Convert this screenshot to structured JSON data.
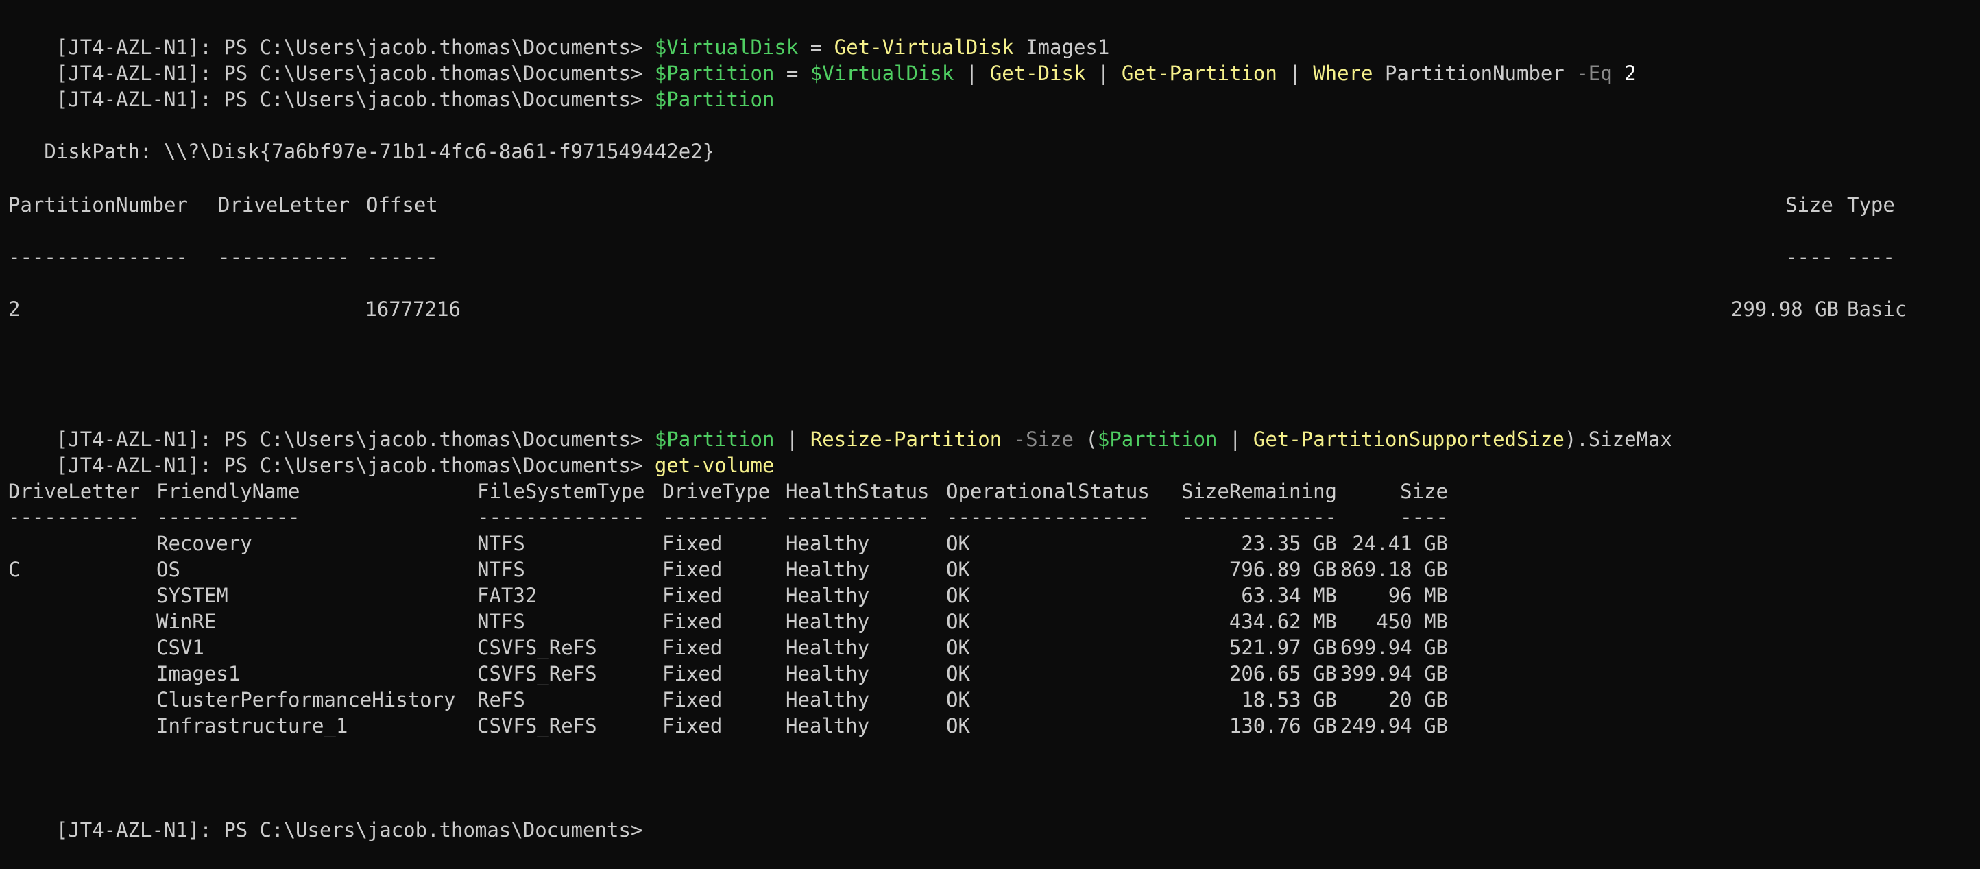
{
  "terminal": {
    "prompt": "[JT4-AZL-N1]: PS C:\\Users\\jacob.thomas\\Documents> ",
    "colors": {
      "background": "#0c0c0c",
      "foreground": "#cccccc",
      "variable": "#4fce62",
      "command": "#f5f08b",
      "parameter": "#8a8a8a"
    },
    "cmd1": {
      "var": "$VirtualDisk",
      "op": " = ",
      "cmd": "Get-VirtualDisk",
      "arg": " Images1"
    },
    "cmd2": {
      "var": "$Partition",
      "op": " = ",
      "var2": "$VirtualDisk",
      "pipe1": " | ",
      "cmd1": "Get-Disk",
      "pipe2": " | ",
      "cmd2": "Get-Partition",
      "pipe3": " | ",
      "where": "Where",
      "arg": " PartitionNumber ",
      "param": "-Eq",
      "num": " 2"
    },
    "cmd3": {
      "var": "$Partition"
    },
    "partition_output": {
      "disk_path": "   DiskPath: \\\\?\\Disk{7a6bf97e-71b1-4fc6-8a61-f971549442e2}",
      "headers": {
        "number": "PartitionNumber",
        "letter": "DriveLetter",
        "offset": "Offset",
        "size": "Size",
        "type": "Type"
      },
      "dashes": {
        "number": "---------------",
        "letter": "-----------",
        "offset": "------",
        "size": "----",
        "type": "----"
      },
      "row": {
        "number": "2",
        "letter": "",
        "offset": "16777216",
        "size": "299.98 GB",
        "type": "Basic"
      }
    },
    "cmd4": {
      "var": "$Partition",
      "pipe1": " | ",
      "cmd1": "Resize-Partition",
      "sp": " ",
      "param": "-Size",
      "open": " (",
      "var2": "$Partition",
      "pipe2": " | ",
      "cmd2": "Get-PartitionSupportedSize",
      "close": ").SizeMax"
    },
    "cmd5": {
      "cmd": "get-volume"
    },
    "volume_table": {
      "headers": {
        "letter": "DriveLetter",
        "name": "FriendlyName",
        "fs": "FileSystemType",
        "dtype": "DriveType",
        "health": "HealthStatus",
        "op": "OperationalStatus",
        "remaining": "SizeRemaining",
        "size": "Size"
      },
      "dashes": {
        "letter": "-----------",
        "name": "------------",
        "fs": "--------------",
        "dtype": "---------",
        "health": "------------",
        "op": "-----------------",
        "remaining": "-------------",
        "size": "----"
      },
      "rows": [
        {
          "letter": "",
          "name": "Recovery",
          "fs": "NTFS",
          "dtype": "Fixed",
          "health": "Healthy",
          "op": "OK",
          "remaining": "23.35 GB",
          "size": "24.41 GB"
        },
        {
          "letter": "C",
          "name": "OS",
          "fs": "NTFS",
          "dtype": "Fixed",
          "health": "Healthy",
          "op": "OK",
          "remaining": "796.89 GB",
          "size": "869.18 GB"
        },
        {
          "letter": "",
          "name": "SYSTEM",
          "fs": "FAT32",
          "dtype": "Fixed",
          "health": "Healthy",
          "op": "OK",
          "remaining": "63.34 MB",
          "size": "96 MB"
        },
        {
          "letter": "",
          "name": "WinRE",
          "fs": "NTFS",
          "dtype": "Fixed",
          "health": "Healthy",
          "op": "OK",
          "remaining": "434.62 MB",
          "size": "450 MB"
        },
        {
          "letter": "",
          "name": "CSV1",
          "fs": "CSVFS_ReFS",
          "dtype": "Fixed",
          "health": "Healthy",
          "op": "OK",
          "remaining": "521.97 GB",
          "size": "699.94 GB"
        },
        {
          "letter": "",
          "name": "Images1",
          "fs": "CSVFS_ReFS",
          "dtype": "Fixed",
          "health": "Healthy",
          "op": "OK",
          "remaining": "206.65 GB",
          "size": "399.94 GB"
        },
        {
          "letter": "",
          "name": "ClusterPerformanceHistory",
          "fs": "ReFS",
          "dtype": "Fixed",
          "health": "Healthy",
          "op": "OK",
          "remaining": "18.53 GB",
          "size": "20 GB"
        },
        {
          "letter": "",
          "name": "Infrastructure_1",
          "fs": "CSVFS_ReFS",
          "dtype": "Fixed",
          "health": "Healthy",
          "op": "OK",
          "remaining": "130.76 GB",
          "size": "249.94 GB"
        }
      ]
    }
  }
}
